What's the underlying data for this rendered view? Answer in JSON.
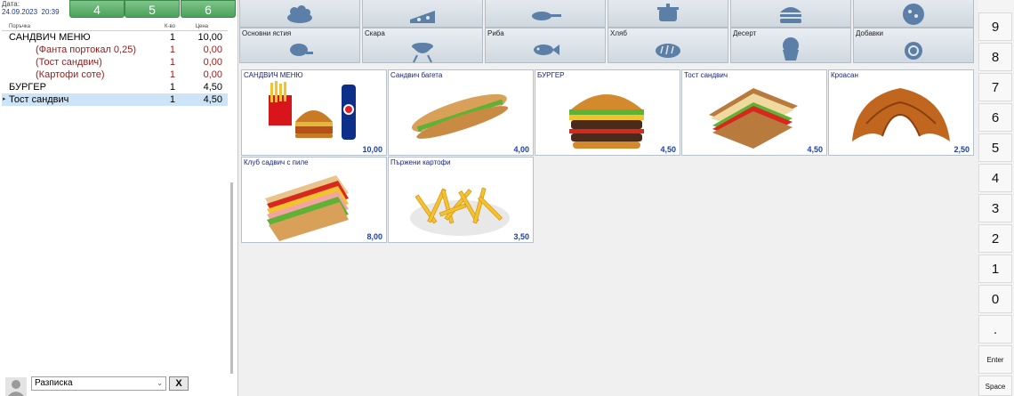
{
  "header": {
    "date_label": "Дата:",
    "date_value": "24.09.2023",
    "time_value": "20:39",
    "quick_buttons": [
      "4",
      "5",
      "6"
    ]
  },
  "order": {
    "columns": [
      "Поръчка",
      "К-во",
      "Цена"
    ],
    "rows": [
      {
        "name": "САНДВИЧ МЕНЮ",
        "qty": "1",
        "price": "10,00",
        "type": "item"
      },
      {
        "name": "(Фанта портокал 0,25)",
        "qty": "1",
        "price": "0,00",
        "type": "mod"
      },
      {
        "name": "(Тост сандвич)",
        "qty": "1",
        "price": "0,00",
        "type": "mod"
      },
      {
        "name": "(Картофи соте)",
        "qty": "1",
        "price": "0,00",
        "type": "mod"
      },
      {
        "name": "БУРГЕР",
        "qty": "1",
        "price": "4,50",
        "type": "item"
      },
      {
        "name": "Тост сандвич",
        "qty": "1",
        "price": "4,50",
        "type": "selected"
      }
    ],
    "selected_marker": "▸"
  },
  "footer": {
    "receipt_option": "Разписка",
    "clear_label": "X"
  },
  "categories": [
    {
      "label": "",
      "icon": "salad-icon"
    },
    {
      "label": "",
      "icon": "cheese-icon"
    },
    {
      "label": "",
      "icon": "pan-icon"
    },
    {
      "label": "",
      "icon": "pot-icon"
    },
    {
      "label": "",
      "icon": "burger-icon"
    },
    {
      "label": "",
      "icon": "pizza-icon"
    },
    {
      "label": "Основни ястия",
      "icon": "chicken-icon"
    },
    {
      "label": "Скара",
      "icon": "grill-icon"
    },
    {
      "label": "Риба",
      "icon": "fish-icon"
    },
    {
      "label": "Хляб",
      "icon": "bread-icon"
    },
    {
      "label": "Десерт",
      "icon": "cupcake-icon"
    },
    {
      "label": "Добавки",
      "icon": "lemon-icon"
    }
  ],
  "products": [
    {
      "name": "САНДВИЧ МЕНЮ",
      "price": "10,00",
      "icon": "menu-icon"
    },
    {
      "name": "Сандвич багета",
      "price": "4,00",
      "icon": "baguette-icon"
    },
    {
      "name": "БУРГЕР",
      "price": "4,50",
      "icon": "burger-icon"
    },
    {
      "name": "Тост сандвич",
      "price": "4,50",
      "icon": "toast-icon"
    },
    {
      "name": "Кроасан",
      "price": "2,50",
      "icon": "croissant-icon"
    },
    {
      "name": "Клуб садвич с пиле",
      "price": "8,00",
      "icon": "club-sandwich-icon"
    },
    {
      "name": "Пържени картофи",
      "price": "3,50",
      "icon": "fries-icon"
    }
  ],
  "numpad": [
    "9",
    "8",
    "7",
    "6",
    "5",
    "4",
    "3",
    "2",
    "1",
    "0",
    ".",
    "Enter",
    "Space"
  ]
}
